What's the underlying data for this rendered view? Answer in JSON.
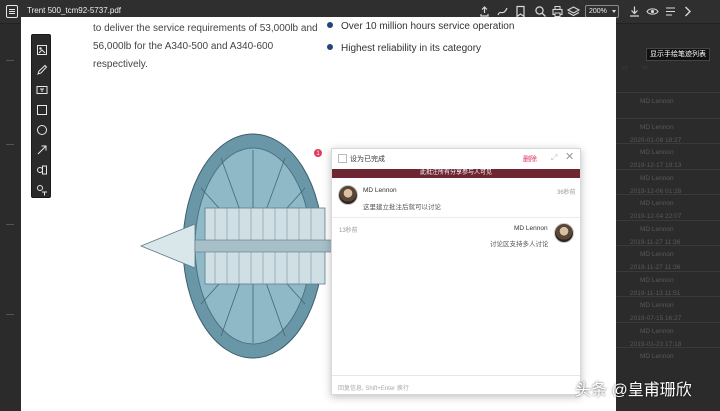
{
  "window": {
    "title": "Trent 500_tcm92-5737.pdf",
    "zoom": "200%"
  },
  "toolbar_icons": [
    "sidebar-icon",
    "share-icon",
    "hand-draw-icon",
    "bookmark-icon",
    "search-icon",
    "text-search-icon",
    "print-icon",
    "layers-icon",
    "download-icon",
    "eye-icon",
    "chevron-right-icon"
  ],
  "page": {
    "para_line1": "to deliver the service requirements of 53,000lb and",
    "para_line2": "56,000lb for the A340-500 and A340-600 respectively.",
    "bullets": [
      "Over 10 million hours service operation",
      "Highest reliability in its category"
    ]
  },
  "palette_tools": [
    "select-icon",
    "pen-icon",
    "text-box-icon",
    "rectangle-icon",
    "circle-icon",
    "arrow-icon",
    "comment-icon",
    "text-tool-icon"
  ],
  "badge_count": "1",
  "comment_panel": {
    "mark_done": "设为已完成",
    "delete": "删除",
    "banner": "此批注所有分享参与人可见",
    "comments": [
      {
        "author": "MD Lennon",
        "time": "36秒前",
        "text": "这里建立批注后就可以讨论"
      },
      {
        "author": "MD Lennon",
        "time": "13秒前",
        "text": "讨论区支持多人讨论"
      }
    ],
    "reply_placeholder": "回复信息, Shift+Enter 换行"
  },
  "right_panel": {
    "tooltip": "显示手绘笔迹列表",
    "entries": [
      {
        "author": "MD Lennon",
        "date": ""
      },
      {
        "author": "MD Lennon",
        "date": "2020-01-08 18:27"
      },
      {
        "author": "MD Lennon",
        "date": "2019-12-17 19:13"
      },
      {
        "author": "MD Lennon",
        "date": "2019-12-06 01:28"
      },
      {
        "author": "MD Lennon",
        "date": "2019-12-04 22:07"
      },
      {
        "author": "MD Lennon",
        "date": "2019-11-27 11:36"
      },
      {
        "author": "MD Lennon",
        "date": "2019-11-27 11:36"
      },
      {
        "author": "MD Lennon",
        "date": "2019-11-13 11:51"
      },
      {
        "author": "MD Lennon",
        "date": "2019-07-15 16:27"
      },
      {
        "author": "MD Lennon",
        "date": "2019-01-23 17:18"
      },
      {
        "author": "MD Lennon",
        "date": ""
      }
    ]
  },
  "watermark": "头条 @皇甫珊欣"
}
